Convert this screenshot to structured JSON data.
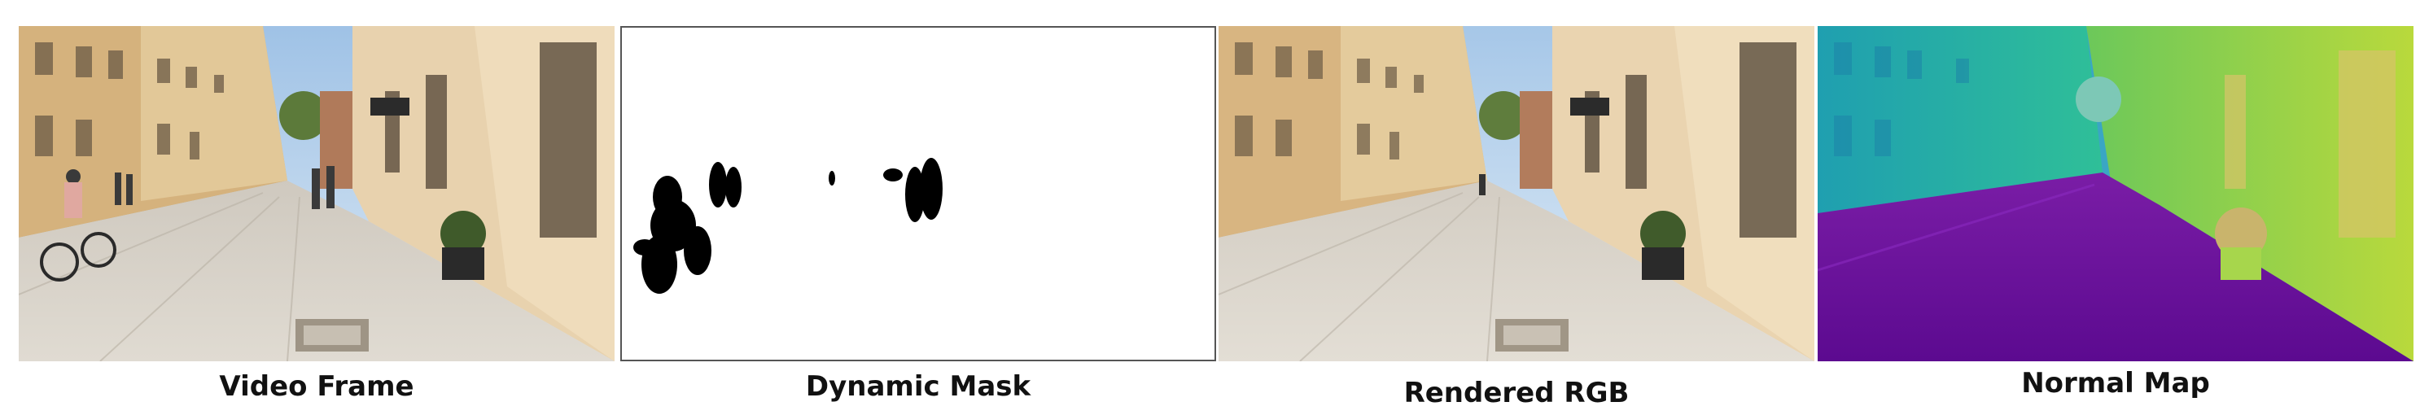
{
  "panels": [
    {
      "id": "video-frame",
      "caption": "Video Frame"
    },
    {
      "id": "dynamic-mask",
      "caption": "Dynamic Mask"
    },
    {
      "id": "rendered-rgb",
      "caption": "Rendered RGB"
    },
    {
      "id": "normal-map",
      "caption": "Normal Map"
    }
  ],
  "colors": {
    "sky": "#bcd6ee",
    "building_left": "#d9b98a",
    "building_right": "#e8d2ae",
    "pavement": "#d6d0c6",
    "mask_fg": "#000000",
    "mask_bg": "#ffffff",
    "normal_ground": "#6a0f9c",
    "normal_left": "#23b7a0",
    "normal_right": "#9fd64a"
  }
}
